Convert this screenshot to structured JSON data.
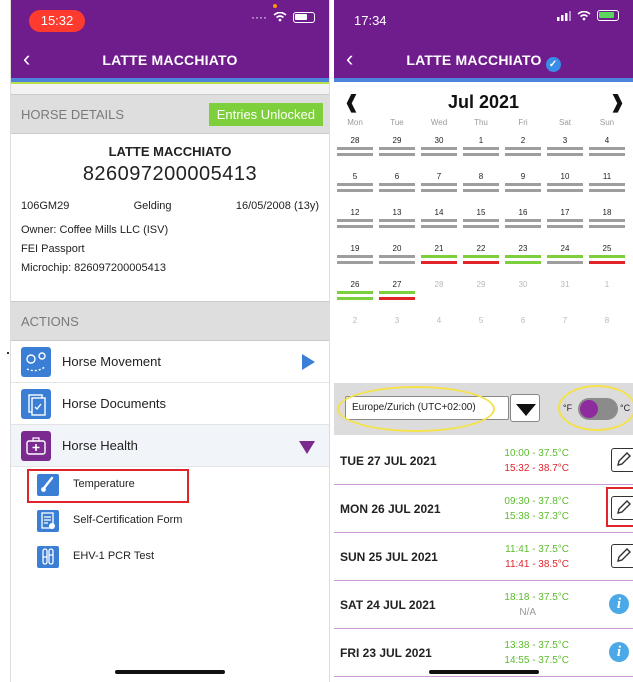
{
  "phone1": {
    "status_time": "15:32",
    "title": "LATTE MACCHIATO",
    "horse_details": {
      "section_label": "HORSE DETAILS",
      "entries_button": "Entries Unlocked",
      "name": "LATTE MACCHIATO",
      "id": "826097200005413",
      "code": "106GM29",
      "sex": "Gelding",
      "dob": "16/05/2008 (13y)",
      "owner": "Owner:  Coffee Mills LLC (ISV)",
      "passport": "FEI Passport",
      "microchip": "Microchip:  826097200005413"
    },
    "actions": {
      "section_label": "ACTIONS",
      "items": [
        {
          "label": "Horse Movement",
          "icon": "horse-movement-icon"
        },
        {
          "label": "Horse Documents",
          "icon": "documents-icon"
        },
        {
          "label": "Horse Health",
          "icon": "medical-kit-icon"
        }
      ],
      "sub_items": [
        {
          "label": "Temperature",
          "icon": "thermometer-icon"
        },
        {
          "label": "Self-Certification Form",
          "icon": "certificate-form-icon"
        },
        {
          "label": "EHV-1 PCR Test",
          "icon": "test-tubes-icon"
        }
      ]
    },
    "colors": {
      "header": "#6f1d8d",
      "accent": "#4b84d8",
      "unlock": "#7dcf3b",
      "highlight": "#e0242a"
    }
  },
  "phone2": {
    "status_time": "17:34",
    "title": "LATTE MACCHIATO",
    "calendar": {
      "month": "Jul 2021",
      "prev": "❰",
      "next": "❱",
      "weekdays": [
        "Mon",
        "Tue",
        "Wed",
        "Thu",
        "Fri",
        "Sat",
        "Sun"
      ],
      "weeks": [
        [
          {
            "d": "28",
            "b": [
              "#9e9e9e",
              "#9e9e9e"
            ]
          },
          {
            "d": "29",
            "b": [
              "#9e9e9e",
              "#9e9e9e"
            ]
          },
          {
            "d": "30",
            "b": [
              "#9e9e9e",
              "#9e9e9e"
            ]
          },
          {
            "d": "1",
            "b": [
              "#9e9e9e",
              "#9e9e9e"
            ]
          },
          {
            "d": "2",
            "b": [
              "#9e9e9e",
              "#9e9e9e"
            ]
          },
          {
            "d": "3",
            "b": [
              "#9e9e9e",
              "#9e9e9e"
            ]
          },
          {
            "d": "4",
            "b": [
              "#9e9e9e",
              "#9e9e9e"
            ]
          }
        ],
        [
          {
            "d": "5",
            "b": [
              "#9e9e9e",
              "#9e9e9e"
            ]
          },
          {
            "d": "6",
            "b": [
              "#9e9e9e",
              "#9e9e9e"
            ]
          },
          {
            "d": "7",
            "b": [
              "#9e9e9e",
              "#9e9e9e"
            ]
          },
          {
            "d": "8",
            "b": [
              "#9e9e9e",
              "#9e9e9e"
            ]
          },
          {
            "d": "9",
            "b": [
              "#9e9e9e",
              "#9e9e9e"
            ]
          },
          {
            "d": "10",
            "b": [
              "#9e9e9e",
              "#9e9e9e"
            ]
          },
          {
            "d": "11",
            "b": [
              "#9e9e9e",
              "#9e9e9e"
            ]
          }
        ],
        [
          {
            "d": "12",
            "b": [
              "#9e9e9e",
              "#9e9e9e"
            ]
          },
          {
            "d": "13",
            "b": [
              "#9e9e9e",
              "#9e9e9e"
            ]
          },
          {
            "d": "14",
            "b": [
              "#9e9e9e",
              "#9e9e9e"
            ]
          },
          {
            "d": "15",
            "b": [
              "#9e9e9e",
              "#9e9e9e"
            ]
          },
          {
            "d": "16",
            "b": [
              "#9e9e9e",
              "#9e9e9e"
            ]
          },
          {
            "d": "17",
            "b": [
              "#9e9e9e",
              "#9e9e9e"
            ]
          },
          {
            "d": "18",
            "b": [
              "#9e9e9e",
              "#9e9e9e"
            ]
          }
        ],
        [
          {
            "d": "19",
            "b": [
              "#9e9e9e",
              "#9e9e9e"
            ]
          },
          {
            "d": "20",
            "b": [
              "#9e9e9e",
              "#9e9e9e"
            ]
          },
          {
            "d": "21",
            "b": [
              "#7dcf3b",
              "#e0242a"
            ]
          },
          {
            "d": "22",
            "b": [
              "#7dcf3b",
              "#e0242a"
            ]
          },
          {
            "d": "23",
            "b": [
              "#7dcf3b",
              "#7dcf3b"
            ]
          },
          {
            "d": "24",
            "b": [
              "#7dcf3b",
              "#9e9e9e"
            ]
          },
          {
            "d": "25",
            "b": [
              "#7dcf3b",
              "#e0242a"
            ]
          }
        ],
        [
          {
            "d": "26",
            "b": [
              "#7dcf3b",
              "#7dcf3b"
            ]
          },
          {
            "d": "27",
            "b": [
              "#7dcf3b",
              "#e0242a"
            ]
          },
          {
            "d": "28",
            "dim": true
          },
          {
            "d": "29",
            "dim": true
          },
          {
            "d": "30",
            "dim": true
          },
          {
            "d": "31",
            "dim": true
          },
          {
            "d": "1",
            "dim": true
          }
        ],
        [
          {
            "d": "2",
            "dim": true
          },
          {
            "d": "3",
            "dim": true
          },
          {
            "d": "4",
            "dim": true
          },
          {
            "d": "5",
            "dim": true
          },
          {
            "d": "6",
            "dim": true
          },
          {
            "d": "7",
            "dim": true
          },
          {
            "d": "8",
            "dim": true
          }
        ]
      ]
    },
    "timezone": "Europe/Zurich (UTC+02:00)",
    "unit_f": "°F",
    "unit_c": "°C",
    "readings": [
      {
        "date": "TUE 27 JUL 2021",
        "lines": [
          {
            "t": "10:00 - 37.5°C",
            "c": "g"
          },
          {
            "t": "15:32 - 38.7°C",
            "c": "r"
          }
        ],
        "action": "edit"
      },
      {
        "date": "MON 26 JUL 2021",
        "lines": [
          {
            "t": "09:30 - 37.8°C",
            "c": "g"
          },
          {
            "t": "15:38 - 37.3°C",
            "c": "g"
          }
        ],
        "action": "edit"
      },
      {
        "date": "SUN 25 JUL 2021",
        "lines": [
          {
            "t": "11:41 - 37.5°C",
            "c": "g"
          },
          {
            "t": "11:41 - 38.5°C",
            "c": "r"
          }
        ],
        "action": "edit"
      },
      {
        "date": "SAT 24 JUL 2021",
        "lines": [
          {
            "t": "18:18 - 37.5°C",
            "c": "g"
          },
          {
            "t": "N/A",
            "c": "n"
          }
        ],
        "action": "info"
      },
      {
        "date": "FRI 23 JUL 2021",
        "lines": [
          {
            "t": "13:38 - 37.5°C",
            "c": "g"
          },
          {
            "t": "14:55 - 37.5°C",
            "c": "g"
          }
        ],
        "action": "info"
      }
    ],
    "info_glyph": "i",
    "colors": {
      "ok": "#5cbc2c",
      "fever": "#e0242a",
      "toggle": "#8e2c9f",
      "annotation": "#f4e24b"
    }
  }
}
